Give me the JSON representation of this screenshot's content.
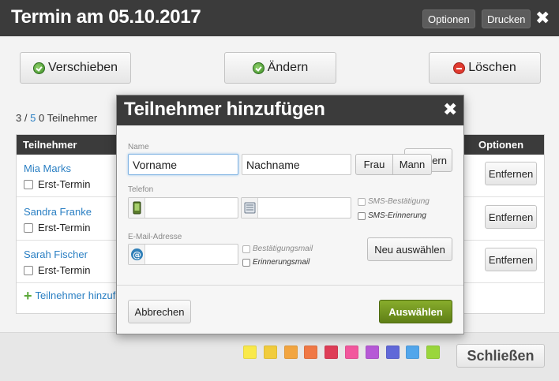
{
  "window": {
    "title": "Termin am 05.10.2017",
    "options_label": "Optionen",
    "print_label": "Drucken",
    "close_glyph": "✖"
  },
  "actions": {
    "move_label": "Verschieben",
    "edit_label": "Ändern",
    "delete_label": "Löschen"
  },
  "participants": {
    "count_current": "3",
    "count_separator": "/",
    "count_max": "5",
    "count_pending": "0",
    "count_suffix": "Teilnehmer",
    "col_participant": "Teilnehmer",
    "col_options": "Optionen",
    "first_appointment_label": "Erst-Termin",
    "remove_label": "Entfernen",
    "add_label": "Teilnehmer hinzufügen",
    "add_label_visible": "Teilnehmer hinzuf",
    "rows": [
      {
        "name": "Mia Marks"
      },
      {
        "name": "Sandra Franke"
      },
      {
        "name": "Sarah Fischer"
      }
    ]
  },
  "hidden_button_fragment": "ern",
  "footer": {
    "close_label": "Schließen",
    "colors": [
      "#f9e94a",
      "#f1cc3d",
      "#f2a540",
      "#f07845",
      "#de3d57",
      "#f2579d",
      "#b659d6",
      "#6068d8",
      "#52a6eb",
      "#9ad63c"
    ]
  },
  "modal": {
    "title": "Teilnehmer hinzufügen",
    "close_glyph": "✖",
    "name_label": "Name",
    "firstname_value": "Vorname",
    "lastname_value": "Nachname",
    "gender_female": "Frau",
    "gender_male": "Mann",
    "phone_label": "Telefon",
    "sms_confirm_label": "SMS-Bestätigung",
    "sms_reminder_label": "SMS-Erinnerung",
    "email_label": "E-Mail-Adresse",
    "confirm_mail_label": "Bestätigungsmail",
    "reminder_mail_label": "Erinnerungsmail",
    "select_new_label": "Neu auswählen",
    "cancel_label": "Abbrechen",
    "choose_label": "Auswählen"
  },
  "colors": {
    "header_bg": "#3b3b3b",
    "link": "#2a7fc3",
    "primary_button": "#6d8f1d"
  }
}
